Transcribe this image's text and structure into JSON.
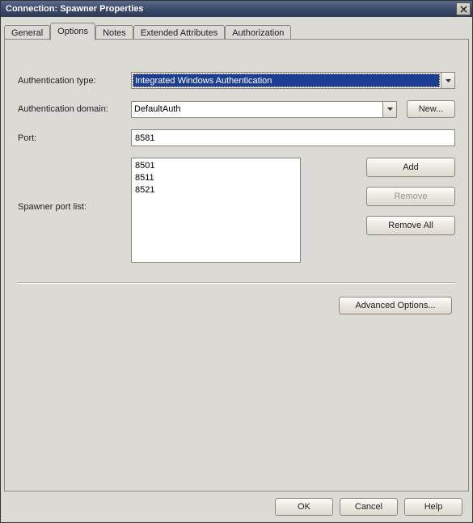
{
  "window": {
    "title": "Connection: Spawner Properties"
  },
  "tabs": {
    "general": "General",
    "options": "Options",
    "notes": "Notes",
    "extended": "Extended Attributes",
    "authorization": "Authorization"
  },
  "labels": {
    "auth_type": "Authentication type:",
    "auth_domain": "Authentication domain:",
    "port": "Port:",
    "spawner_port_list": "Spawner port list:"
  },
  "fields": {
    "auth_type_value": "Integrated Windows Authentication",
    "auth_domain_value": "DefaultAuth",
    "port_value": "8581"
  },
  "port_list": [
    "8501",
    "8511",
    "8521"
  ],
  "buttons": {
    "new": "New...",
    "add": "Add",
    "remove": "Remove",
    "remove_all": "Remove All",
    "advanced": "Advanced Options...",
    "ok": "OK",
    "cancel": "Cancel",
    "help": "Help"
  }
}
